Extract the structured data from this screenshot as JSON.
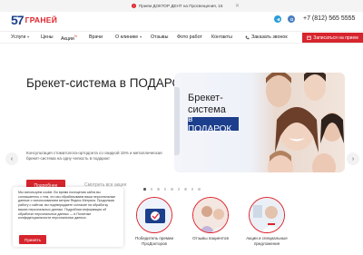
{
  "topbar": {
    "notice_icon": "!",
    "notice": "Прием ДОКТОР ДЕНТ на Просвещения, 15",
    "close": "✕"
  },
  "header": {
    "logo_number": "57",
    "logo_text": "ГРАНЕЙ",
    "phone": "+7 (812) 565 5555",
    "social": [
      "telegram-icon",
      "vk-icon"
    ]
  },
  "nav": {
    "items": [
      "Услуги",
      "Цены",
      "Акции",
      "Врачи",
      "О клинике",
      "Отзывы",
      "Фото работ",
      "Контакты"
    ],
    "promo_badge": "%",
    "call": "Заказать звонок",
    "book": "Записаться на прием"
  },
  "hero": {
    "title": "Брекет-система в ПОДАРОК",
    "description": "Консультация стоматолога-ортодонта со скидкой 15% и металлическая брекет-система на одну челюсть в подарок!",
    "cta": "Подробнее",
    "all_promos": "Смотреть все акции",
    "promo_line1": "Брекет-",
    "promo_line2": "система",
    "promo_highlight": "в ПОДАРОК"
  },
  "slider": {
    "count": 9,
    "active": 0
  },
  "cards": [
    {
      "label": "Победитель премии ПроДокторов"
    },
    {
      "label": "Отзывы пациентов"
    },
    {
      "label": "Акции и специальные предложения"
    }
  ],
  "cookie": {
    "text": "Мы используем cookie. Во время посещения сайта вы соглашаетесь с тем, что мы обрабатываем ваши персональные данные с использованием метрик Яндекс Метрика. Продолжая работу с сайтом, вы подтверждаете согласие на обработку ваших персональных данных. Подробная информация об обработке персональных данных — в Политике конфиденциальности персональных данных.",
    "accept": "Принять"
  },
  "colors": {
    "brand_red": "#d7252d",
    "brand_blue": "#1c3e8c"
  }
}
